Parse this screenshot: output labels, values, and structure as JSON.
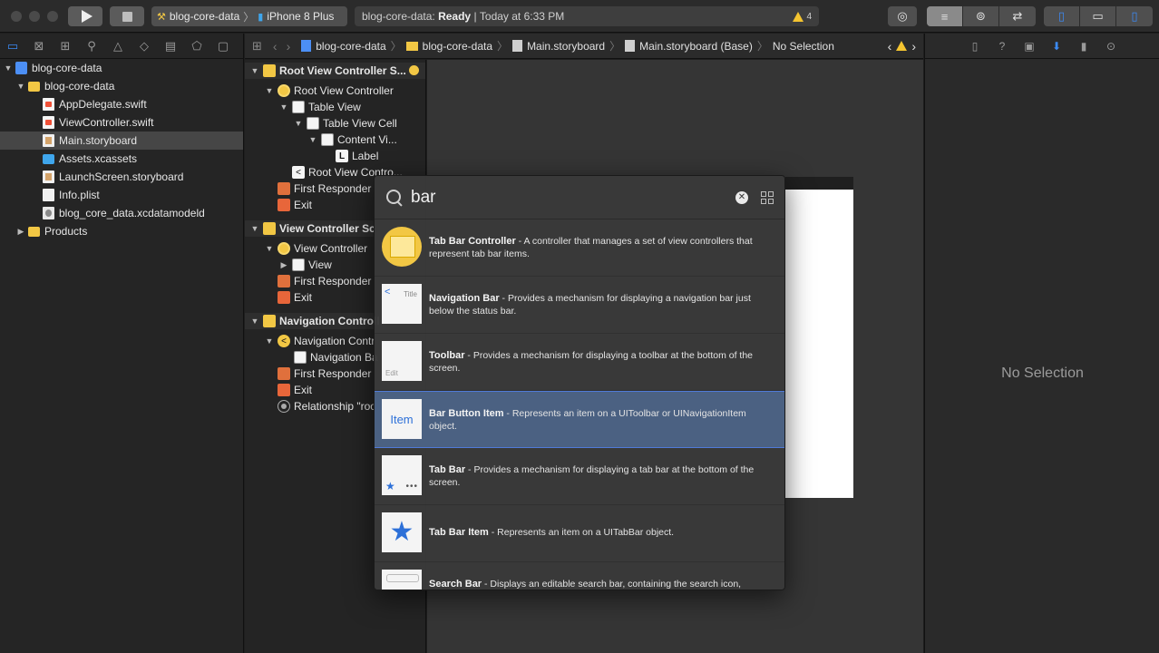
{
  "toolbar": {
    "scheme_project": "blog-core-data",
    "scheme_device": "iPhone 8 Plus",
    "activity_project": "blog-core-data:",
    "activity_status": "Ready",
    "activity_separator": "|",
    "activity_time": "Today at 6:33 PM",
    "warning_count": "4"
  },
  "navigator": {
    "items": [
      {
        "label": "blog-core-data",
        "disclosure": "▼",
        "icon": "project"
      },
      {
        "label": "blog-core-data",
        "disclosure": "▼",
        "icon": "folder"
      },
      {
        "label": "AppDelegate.swift",
        "icon": "swift-file"
      },
      {
        "label": "ViewController.swift",
        "icon": "swift-file"
      },
      {
        "label": "Main.storyboard",
        "icon": "storyboard-file",
        "selected": true
      },
      {
        "label": "Assets.xcassets",
        "icon": "assets-folder"
      },
      {
        "label": "LaunchScreen.storyboard",
        "icon": "storyboard-file"
      },
      {
        "label": "Info.plist",
        "icon": "plist-file"
      },
      {
        "label": "blog_core_data.xcdatamodeld",
        "icon": "data-model-file"
      },
      {
        "label": "Products",
        "disclosure": "▶",
        "icon": "folder"
      }
    ]
  },
  "jumpbar": {
    "crumbs": [
      "blog-core-data",
      "blog-core-data",
      "Main.storyboard",
      "Main.storyboard (Base)",
      "No Selection"
    ]
  },
  "outline": {
    "rows": [
      {
        "label": "Root View Controller S...",
        "disclosure": "▼"
      },
      {
        "label": "Root View Controller",
        "disclosure": "▼"
      },
      {
        "label": "Table View",
        "disclosure": "▼"
      },
      {
        "label": "Table View Cell",
        "disclosure": "▼"
      },
      {
        "label": "Content Vi...",
        "disclosure": "▼"
      },
      {
        "label": "Label",
        "glyph": "L"
      },
      {
        "label": "Root View Contro...",
        "glyph": "<"
      },
      {
        "label": "First Responder"
      },
      {
        "label": "Exit"
      },
      {
        "label": "View Controller Sc",
        "disclosure": "▼"
      },
      {
        "label": "View Controller",
        "disclosure": "▼"
      },
      {
        "label": "View",
        "disclosure": "▶"
      },
      {
        "label": "First Responder"
      },
      {
        "label": "Exit"
      },
      {
        "label": "Navigation Controll",
        "disclosure": "▼"
      },
      {
        "label": "Navigation Contr",
        "disclosure": "▼",
        "glyph": "<"
      },
      {
        "label": "Navigation Ba"
      },
      {
        "label": "First Responder"
      },
      {
        "label": "Exit"
      },
      {
        "label": "Relationship \"roo"
      }
    ]
  },
  "library": {
    "search_value": "bar",
    "clear_glyph": "✕",
    "items": [
      {
        "title": "Tab Bar Controller",
        "desc": " - A controller that manages a set of view controllers that represent tab bar items."
      },
      {
        "title": "Navigation Bar",
        "desc": " - Provides a mechanism for displaying a navigation bar just below the status bar.",
        "thumb_text": "Title",
        "thumb_glyph": "<"
      },
      {
        "title": "Toolbar",
        "desc": " - Provides a mechanism for displaying a toolbar at the bottom of the screen.",
        "thumb_text": "Edit"
      },
      {
        "title": "Bar Button Item",
        "desc": " - Represents an item on a UIToolbar or UINavigationItem object.",
        "thumb_text": "Item",
        "selected": true
      },
      {
        "title": "Tab Bar",
        "desc": " - Provides a mechanism for displaying a tab bar at the bottom of the screen.",
        "thumb_glyph": "★",
        "thumb_dots": "•••"
      },
      {
        "title": "Tab Bar Item",
        "desc": " - Represents an item on a UITabBar object.",
        "thumb_glyph": "★"
      },
      {
        "title": "Search Bar",
        "desc": " - Displays an editable search bar, containing the search icon,"
      }
    ]
  },
  "inspector": {
    "empty_label": "No Selection"
  },
  "colors": {
    "accent": "#3b8af5",
    "warning": "#f4c430",
    "selection": "#526f9b"
  }
}
